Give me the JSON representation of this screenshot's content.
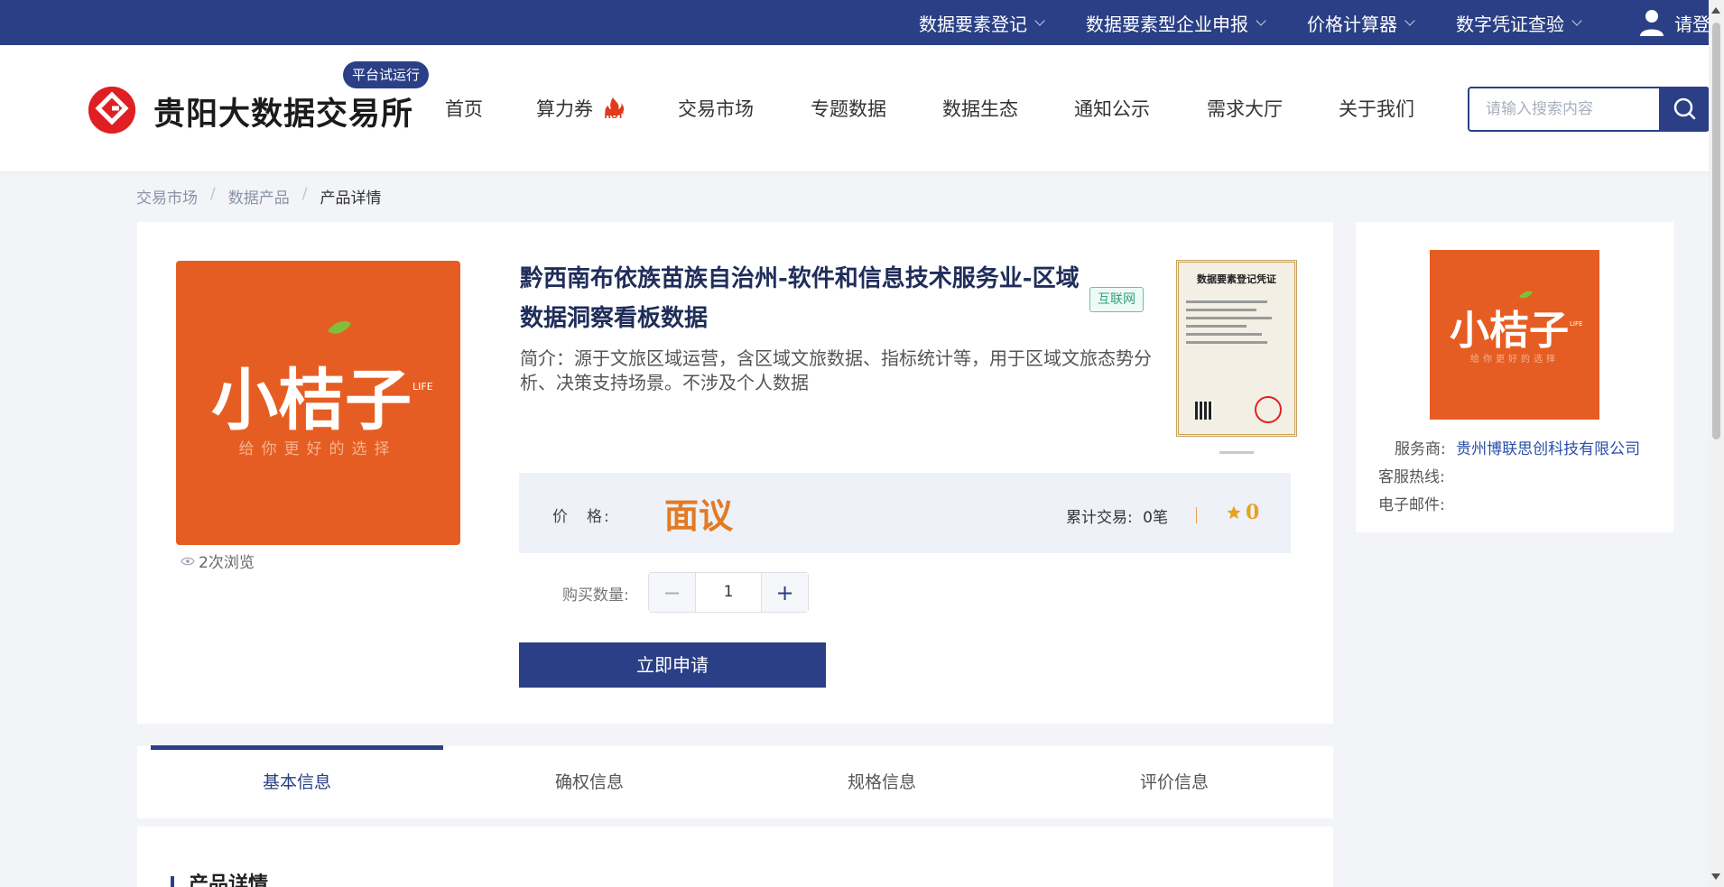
{
  "topbar": {
    "menus": [
      {
        "label": "数据要素登记"
      },
      {
        "label": "数据要素型企业申报"
      },
      {
        "label": "价格计算器"
      },
      {
        "label": "数字凭证查验"
      }
    ],
    "user_label": "请登"
  },
  "header": {
    "brand": "贵阳大数据交易所",
    "trial_badge": "平台试运行",
    "nav": [
      {
        "label": "首页"
      },
      {
        "label": "算力券"
      },
      {
        "label": "交易市场"
      },
      {
        "label": "专题数据"
      },
      {
        "label": "数据生态"
      },
      {
        "label": "通知公示"
      },
      {
        "label": "需求大厅"
      },
      {
        "label": "关于我们"
      }
    ],
    "hot_badge": "HOT",
    "search_placeholder": "请输入搜索内容"
  },
  "breadcrumb": {
    "items": [
      "交易市场",
      "数据产品",
      "产品详情"
    ],
    "separator": "/"
  },
  "product": {
    "image_text": "小桔子",
    "image_slogan": "给你更好的选择",
    "image_sub": "LIFE",
    "views": "2次浏览",
    "title": "黔西南布依族苗族自治州-软件和信息技术服务业-区域数据洞察看板数据",
    "tag": "互联网",
    "intro": "简介：源于文旅区域运营，含区域文旅数据、指标统计等，用于区域文旅态势分析、决策支持场景。不涉及个人数据",
    "certificate_title": "数据要素登记凭证",
    "price_label": "价　格:",
    "price_value": "面议",
    "deals_label": "累计交易:",
    "deals_value": "0笔",
    "rating_value": "0",
    "qty_label": "购买数量:",
    "qty_value": "1",
    "qty_minus": "−",
    "qty_plus": "+",
    "apply_label": "立即申请"
  },
  "provider": {
    "provider_label": "服务商:",
    "provider_name": "贵州博联思创科技有限公司",
    "hotline_label": "客服热线:",
    "email_label": "电子邮件:"
  },
  "tabs": [
    {
      "label": "基本信息"
    },
    {
      "label": "确权信息"
    },
    {
      "label": "规格信息"
    },
    {
      "label": "评价信息"
    }
  ],
  "detail": {
    "section_title": "产品详情"
  },
  "colors": {
    "primary": "#2a3f85",
    "price": "#e37a24",
    "brand_red": "#e01f24",
    "image_orange": "#e65d23"
  },
  "icons": [
    "chevron-down-icon",
    "user-icon",
    "search-icon",
    "eye-icon",
    "star-icon",
    "hot-icon",
    "logo-icon"
  ]
}
